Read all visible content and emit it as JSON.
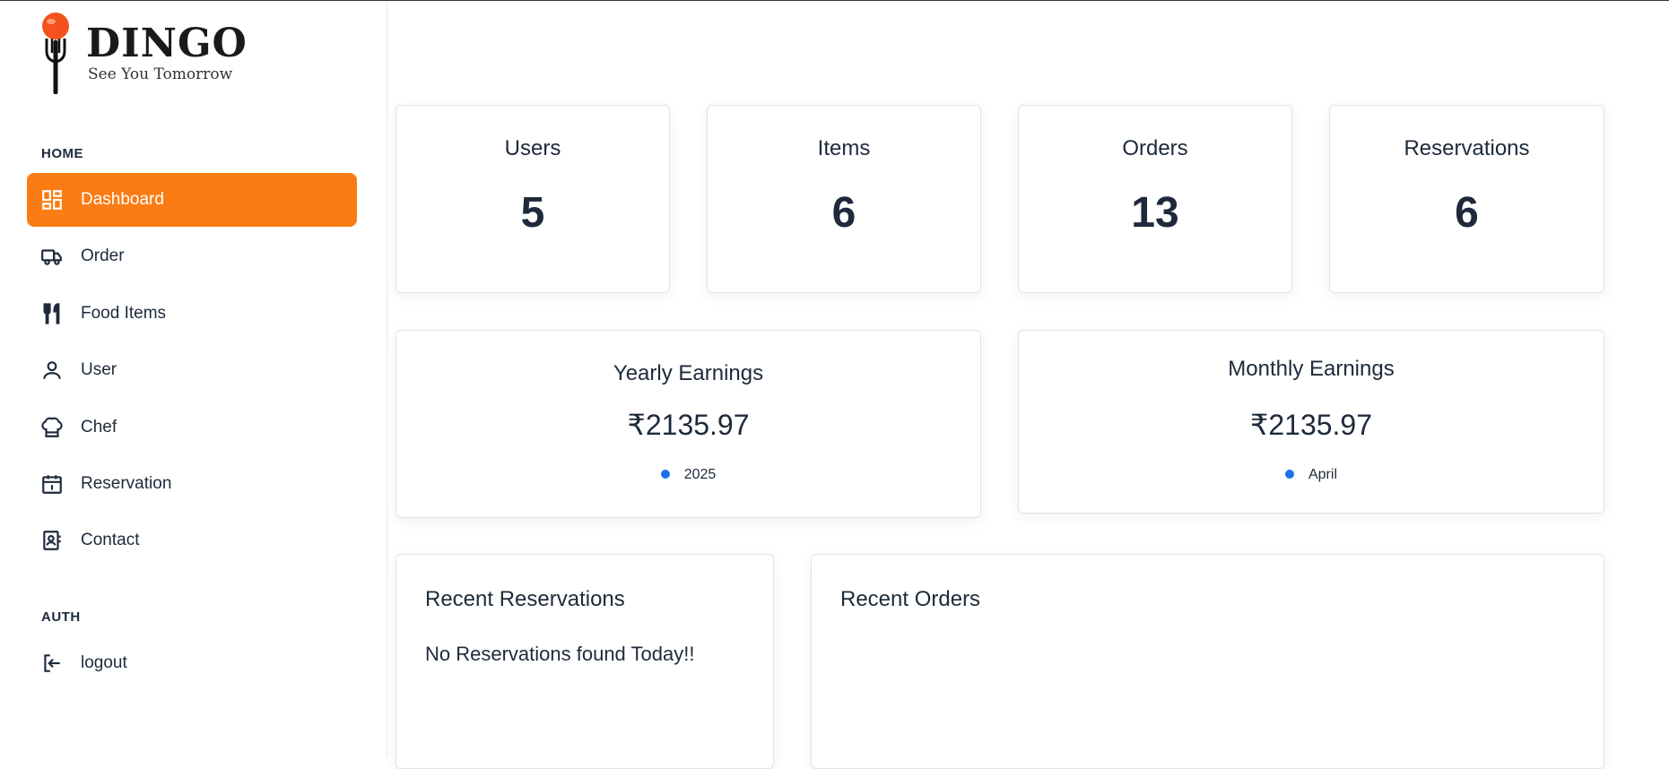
{
  "brand": {
    "name": "DINGO",
    "tagline": "See You Tomorrow"
  },
  "sidebar": {
    "home_label": "HOME",
    "auth_label": "AUTH",
    "items": [
      {
        "label": "Dashboard",
        "icon": "dashboard-icon",
        "active": true
      },
      {
        "label": "Order",
        "icon": "truck-icon"
      },
      {
        "label": "Food Items",
        "icon": "utensils-icon"
      },
      {
        "label": "User",
        "icon": "user-icon"
      },
      {
        "label": "Chef",
        "icon": "chef-hat-icon"
      },
      {
        "label": "Reservation",
        "icon": "calendar-icon"
      },
      {
        "label": "Contact",
        "icon": "contact-book-icon"
      }
    ],
    "auth_items": [
      {
        "label": "logout",
        "icon": "logout-icon"
      }
    ]
  },
  "stats": [
    {
      "title": "Users",
      "value": "5"
    },
    {
      "title": "Items",
      "value": "6"
    },
    {
      "title": "Orders",
      "value": "13"
    },
    {
      "title": "Reservations",
      "value": "6"
    }
  ],
  "earnings": {
    "yearly": {
      "title": "Yearly Earnings",
      "value": "₹2135.97",
      "legend": "2025"
    },
    "monthly": {
      "title": "Monthly Earnings",
      "value": "₹2135.97",
      "legend": "April"
    }
  },
  "recent_reservations": {
    "title": "Recent Reservations",
    "empty_text": "No Reservations found Today!!"
  },
  "recent_orders": {
    "title": "Recent Orders"
  },
  "colors": {
    "accent": "#fb7c14",
    "legend_dot": "#1a73e8",
    "text": "#1e2a3b"
  }
}
